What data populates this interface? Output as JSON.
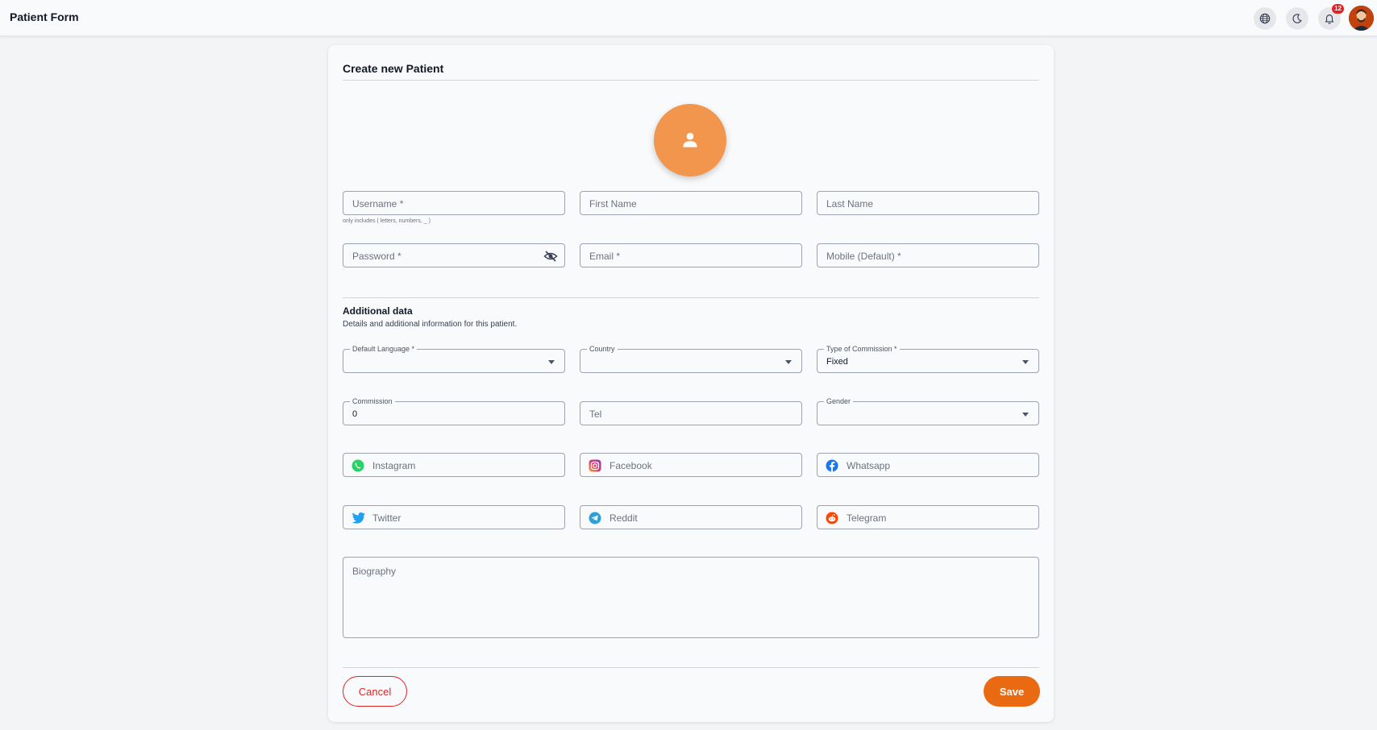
{
  "header": {
    "title": "Patient Form",
    "notification_count": "12",
    "icons": [
      "globe-icon",
      "moon-icon",
      "bell-icon",
      "user-avatar"
    ]
  },
  "form": {
    "title": "Create new Patient",
    "fields": {
      "username": "Username *",
      "username_hint": "only includes ( letters, numbers, _ )",
      "first_name": "First Name",
      "last_name": "Last Name",
      "password": "Password *",
      "email": "Email *",
      "mobile": "Mobile (Default) *"
    },
    "additional": {
      "title": "Additional data",
      "subtitle": "Details and additional information for this patient.",
      "default_language_label": "Default Language *",
      "default_language_value": "",
      "country_label": "Country",
      "country_value": "",
      "commission_type_label": "Type of Commission *",
      "commission_type_value": "Fixed",
      "commission_label": "Commission",
      "commission_value": "0",
      "tel": "Tel",
      "gender_label": "Gender",
      "gender_value": ""
    },
    "social": {
      "instagram": "Instagram",
      "facebook": "Facebook",
      "whatsapp": "Whatsapp",
      "twitter": "Twitter",
      "reddit": "Reddit",
      "telegram": "Telegram"
    },
    "biography": "Biography",
    "cancel_label": "Cancel",
    "save_label": "Save"
  },
  "colors": {
    "accent": "#ea6a12",
    "avatar_bg": "#f2954d",
    "cancel": "#dc2626"
  }
}
